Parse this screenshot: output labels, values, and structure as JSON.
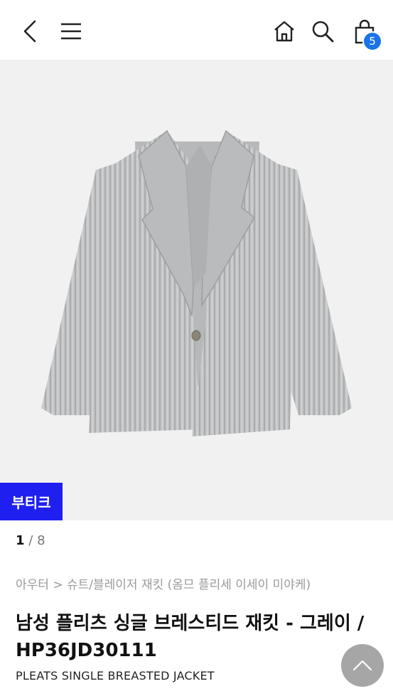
{
  "header": {
    "back_icon": "chevron-left-icon",
    "menu_icon": "hamburger-menu-icon",
    "home_icon": "home-icon",
    "search_icon": "search-icon",
    "cart_icon": "shopping-bag-icon",
    "cart_count": "5",
    "badge_color": "#1a73e8"
  },
  "gallery": {
    "tag_label": "부티크",
    "tag_color": "#1f1ff0",
    "current_page": "1",
    "separator": "/",
    "total_pages": "8"
  },
  "product": {
    "breadcrumb": "아우터 > 슈트/블레이저 재킷 (옴므 플리세 이세이 미야케)",
    "title": "남성 플리츠 싱글 브레스티드 재킷 - 그레이 / HP36JD30111",
    "subtitle": "PLEATS SINGLE BREASTED JACKET"
  },
  "scroll_top_icon": "chevron-up-icon"
}
